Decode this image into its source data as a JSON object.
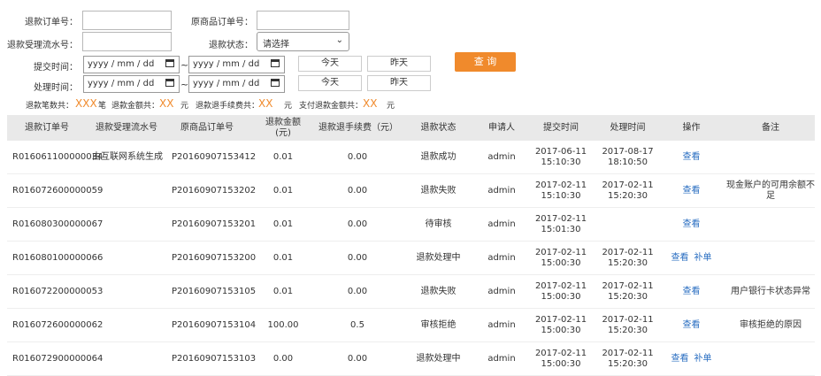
{
  "filters": {
    "refund_order_no_label": "退款订单号：",
    "original_order_no_label": "原商品订单号：",
    "refund_flow_no_label": "退款受理流水号：",
    "refund_status_label": "退款状态：",
    "refund_status_value": "请选择",
    "submit_time_label": "提交时间：",
    "process_time_label": "处理时间：",
    "date_placeholder": "yyyy / mm / dd",
    "range_sep": "~",
    "today_label": "今天",
    "yesterday_label": "昨天",
    "query_label": "查 询"
  },
  "summary": {
    "count_label": "退款笔数共：",
    "count_value": "XXX",
    "count_unit": "笔",
    "amount_label": "退款金额共：",
    "amount_value": "XX",
    "amount_unit": "元",
    "fee_label": "退款退手续费共：",
    "fee_value": "XX",
    "fee_unit": "元",
    "pay_label": "支付退款金额共：",
    "pay_value": "XX",
    "pay_unit": "元"
  },
  "table": {
    "headers": [
      "退款订单号",
      "退款受理流水号",
      "原商品订单号",
      "退款金额\n(元)",
      "退款退手续费（元）",
      "退款状态",
      "申请人",
      "提交时间",
      "处理时间",
      "操作",
      "备注"
    ],
    "rows": [
      {
        "refund_no": "R016061100000034",
        "flow_no": "由互联网系统生成",
        "orig_no": "P20160907153412",
        "amount": "0.01",
        "fee": "0.00",
        "status": "退款成功",
        "applicant": "admin",
        "submit_date": "2017-06-11",
        "submit_time": "15:10:30",
        "process_date": "2017-08-17",
        "process_time": "18:10:50",
        "ops": [
          "查看"
        ],
        "remark": ""
      },
      {
        "refund_no": "R016072600000059",
        "flow_no": "",
        "orig_no": "P20160907153202",
        "amount": "0.01",
        "fee": "0.00",
        "status": "退款失败",
        "applicant": "admin",
        "submit_date": "2017-02-11",
        "submit_time": "15:10:30",
        "process_date": "2017-02-11",
        "process_time": "15:20:30",
        "ops": [
          "查看"
        ],
        "remark": "现金账户的可用余额不足"
      },
      {
        "refund_no": "R016080300000067",
        "flow_no": "",
        "orig_no": "P20160907153201",
        "amount": "0.01",
        "fee": "0.00",
        "status": "待审核",
        "applicant": "admin",
        "submit_date": "2017-02-11",
        "submit_time": "15:01:30",
        "process_date": "",
        "process_time": "",
        "ops": [
          "查看"
        ],
        "remark": ""
      },
      {
        "refund_no": "R016080100000066",
        "flow_no": "",
        "orig_no": "P20160907153200",
        "amount": "0.01",
        "fee": "0.00",
        "status": "退款处理中",
        "applicant": "admin",
        "submit_date": "2017-02-11",
        "submit_time": "15:00:30",
        "process_date": "2017-02-11",
        "process_time": "15:20:30",
        "ops": [
          "查看",
          "补单"
        ],
        "remark": ""
      },
      {
        "refund_no": "R016072200000053",
        "flow_no": "",
        "orig_no": "P20160907153105",
        "amount": "0.01",
        "fee": "0.00",
        "status": "退款失败",
        "applicant": "admin",
        "submit_date": "2017-02-11",
        "submit_time": "15:00:30",
        "process_date": "2017-02-11",
        "process_time": "15:20:30",
        "ops": [
          "查看"
        ],
        "remark": "用户银行卡状态异常"
      },
      {
        "refund_no": "R016072600000062",
        "flow_no": "",
        "orig_no": "P20160907153104",
        "amount": "100.00",
        "fee": "0.5",
        "status": "审核拒绝",
        "applicant": "admin",
        "submit_date": "2017-02-11",
        "submit_time": "15:00:30",
        "process_date": "2017-02-11",
        "process_time": "15:20:30",
        "ops": [
          "查看"
        ],
        "remark": "审核拒绝的原因"
      },
      {
        "refund_no": "R016072900000064",
        "flow_no": "",
        "orig_no": "P20160907153103",
        "amount": "0.00",
        "fee": "0.00",
        "status": "退款处理中",
        "applicant": "admin",
        "submit_date": "2017-02-11",
        "submit_time": "15:00:30",
        "process_date": "2017-02-11",
        "process_time": "15:20:30",
        "ops": [
          "查看",
          "补单"
        ],
        "remark": ""
      }
    ]
  }
}
